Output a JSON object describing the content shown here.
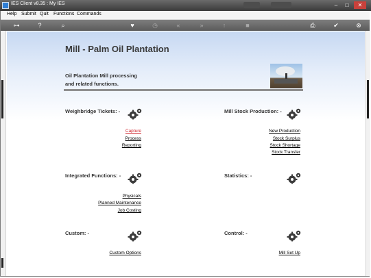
{
  "window": {
    "title": "IES Client v8.35 : My IES"
  },
  "menu": [
    "Help",
    "Submit",
    "Quit",
    "Functions",
    "Commands"
  ],
  "page": {
    "title": "Mill - Palm Oil Plantation",
    "intro_line1": "Oil Plantation Mill processing",
    "intro_line2": "and related functions."
  },
  "sections": {
    "weighbridge": {
      "title": "Weighbridge Tickets: -",
      "links": [
        "Capture",
        "Process",
        "Reporting"
      ]
    },
    "stock": {
      "title": "Mill Stock Production: -",
      "links": [
        "New Production",
        "Stock Surplus",
        "Stock Shortage",
        "Stock Transfer"
      ]
    },
    "integrated": {
      "title": "Integrated Functions: -",
      "links": [
        "Physicals",
        "Planned Maintenance",
        "Job Costing"
      ]
    },
    "statistics": {
      "title": "Statistics: -",
      "links": []
    },
    "custom": {
      "title": "Custom: -",
      "links": [
        "Custom Options"
      ]
    },
    "control": {
      "title": "Control: -",
      "links": [
        "Mill Set Up"
      ]
    }
  },
  "colors": {
    "active_link": "#d0262e",
    "header_gradient_top": "#c6d8f2",
    "rule": "#8f8f8f"
  },
  "icons": [
    "key-icon",
    "help-icon",
    "search-icon",
    "heart-icon",
    "clock-icon",
    "back-icon",
    "forward-icon",
    "upload-icon",
    "stop-icon",
    "print-icon",
    "ok-icon",
    "close-icon",
    "gear-icon"
  ]
}
